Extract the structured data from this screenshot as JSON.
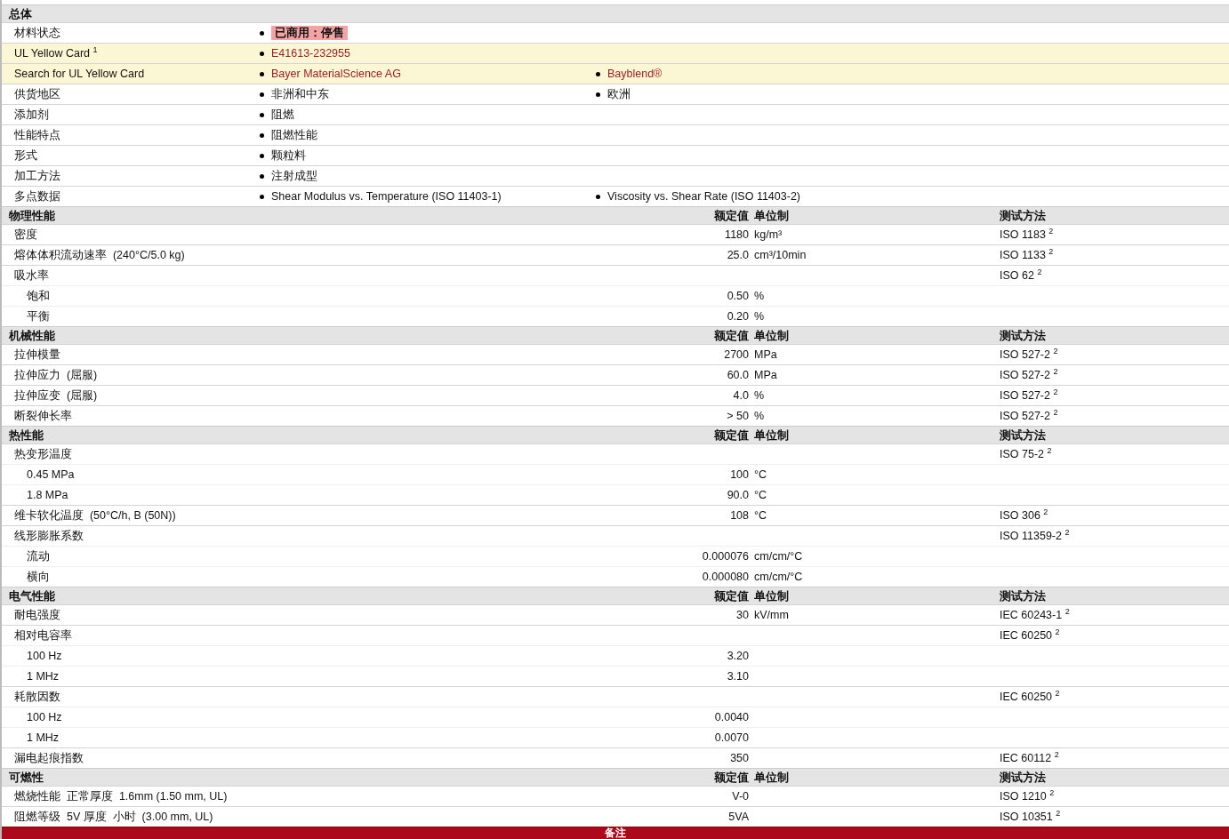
{
  "general": {
    "title": "总体",
    "rows": [
      {
        "label": "材料状态",
        "highlight": false,
        "items": [
          {
            "kind": "status",
            "text": "已商用：停售"
          }
        ]
      },
      {
        "label": "UL Yellow Card $^{1}$",
        "highlight": true,
        "items": [
          {
            "kind": "link",
            "text": "E41613-232955"
          }
        ]
      },
      {
        "label": "Search for UL Yellow Card",
        "highlight": true,
        "items": [
          {
            "kind": "link",
            "text": "Bayer MaterialScience AG"
          },
          {
            "kind": "link",
            "text": "Bayblend®"
          }
        ]
      },
      {
        "label": "供货地区",
        "highlight": false,
        "items": [
          {
            "kind": "text",
            "text": "非洲和中东"
          },
          {
            "kind": "text",
            "text": "欧洲"
          }
        ]
      },
      {
        "label": "添加剂",
        "highlight": false,
        "items": [
          {
            "kind": "text",
            "text": "阻燃"
          }
        ]
      },
      {
        "label": "性能特点",
        "highlight": false,
        "items": [
          {
            "kind": "text",
            "text": "阻燃性能"
          }
        ]
      },
      {
        "label": "形式",
        "highlight": false,
        "items": [
          {
            "kind": "text",
            "text": "颗粒料"
          }
        ]
      },
      {
        "label": "加工方法",
        "highlight": false,
        "items": [
          {
            "kind": "text",
            "text": "注射成型"
          }
        ]
      },
      {
        "label": "多点数据",
        "highlight": false,
        "items": [
          {
            "kind": "text",
            "text": "Shear Modulus vs. Temperature (ISO 11403-1)"
          },
          {
            "kind": "text",
            "text": "Viscosity vs. Shear Rate (ISO 11403-2)"
          }
        ]
      }
    ]
  },
  "sections": [
    {
      "title": "物理性能",
      "value_header": "额定值",
      "unit_header": "单位制",
      "method_header": "测试方法",
      "rows": [
        {
          "label": "密度",
          "value": "1180",
          "unit": "kg/m³",
          "method": "ISO 1183 $^{2}$"
        },
        {
          "label": "熔体体积流动速率  (240°C/5.0 kg)",
          "value": "25.0",
          "unit": "cm³/10min",
          "method": "ISO 1133 $^{2}$"
        },
        {
          "label": "吸水率",
          "method": "ISO 62 $^{2}$",
          "children": [
            {
              "label": "饱和",
              "value": "0.50",
              "unit": "%"
            },
            {
              "label": "平衡",
              "value": "0.20",
              "unit": "%"
            }
          ]
        }
      ]
    },
    {
      "title": "机械性能",
      "value_header": "额定值",
      "unit_header": "单位制",
      "method_header": "测试方法",
      "rows": [
        {
          "label": "拉伸模量",
          "value": "2700",
          "unit": "MPa",
          "method": "ISO 527-2 $^{2}$"
        },
        {
          "label": "拉伸应力  (屈服)",
          "value": "60.0",
          "unit": "MPa",
          "method": "ISO 527-2 $^{2}$"
        },
        {
          "label": "拉伸应变  (屈服)",
          "value": "4.0",
          "unit": "%",
          "method": "ISO 527-2 $^{2}$"
        },
        {
          "label": "断裂伸长率",
          "value": "> 50",
          "unit": "%",
          "method": "ISO 527-2 $^{2}$"
        }
      ]
    },
    {
      "title": "热性能",
      "value_header": "额定值",
      "unit_header": "单位制",
      "method_header": "测试方法",
      "rows": [
        {
          "label": "热变形温度",
          "method": "ISO 75-2 $^{2}$",
          "children": [
            {
              "label": "0.45 MPa",
              "value": "100",
              "unit": "°C"
            },
            {
              "label": "1.8 MPa",
              "value": "90.0",
              "unit": "°C"
            }
          ]
        },
        {
          "label": "维卡软化温度  (50°C/h, B (50N))",
          "value": "108",
          "unit": "°C",
          "method": "ISO 306 $^{2}$"
        },
        {
          "label": "线形膨胀系数",
          "method": "ISO 11359-2 $^{2}$",
          "children": [
            {
              "label": "流动",
              "value": "0.000076",
              "unit": "cm/cm/°C"
            },
            {
              "label": "横向",
              "value": "0.000080",
              "unit": "cm/cm/°C"
            }
          ]
        }
      ]
    },
    {
      "title": "电气性能",
      "value_header": "额定值",
      "unit_header": "单位制",
      "method_header": "测试方法",
      "rows": [
        {
          "label": "耐电强度",
          "value": "30",
          "unit": "kV/mm",
          "method": "IEC 60243-1 $^{2}$"
        },
        {
          "label": "相对电容率",
          "method": "IEC 60250 $^{2}$",
          "children": [
            {
              "label": "100 Hz",
              "value": "3.20"
            },
            {
              "label": "1 MHz",
              "value": "3.10"
            }
          ]
        },
        {
          "label": "耗散因数",
          "method": "IEC 60250 $^{2}$",
          "children": [
            {
              "label": "100 Hz",
              "value": "0.0040"
            },
            {
              "label": "1 MHz",
              "value": "0.0070"
            }
          ]
        },
        {
          "label": "漏电起痕指数",
          "value": "350",
          "method": "IEC 60112 $^{2}$"
        }
      ]
    },
    {
      "title": "可燃性",
      "value_header": "额定值",
      "unit_header": "单位制",
      "method_header": "测试方法",
      "rows": [
        {
          "label": "燃烧性能  正常厚度  1.6mm (1.50 mm, UL)",
          "value": "V-0",
          "method": "ISO 1210 $^{2}$"
        },
        {
          "label": "阻燃等级  5V 厚度  小时  (3.00 mm, UL)",
          "value": "5VA",
          "method": "ISO 10351 $^{2}$"
        }
      ]
    }
  ],
  "footer": {
    "title": "备注"
  }
}
